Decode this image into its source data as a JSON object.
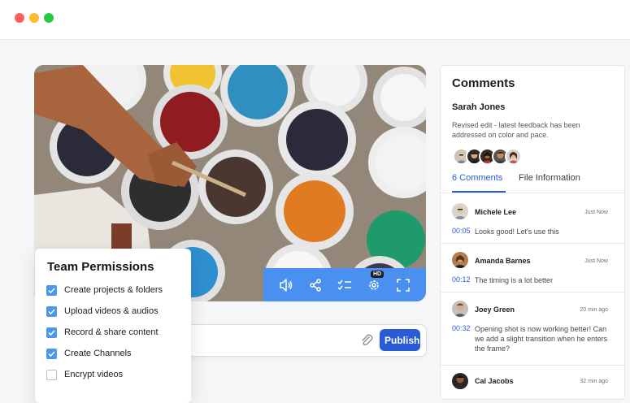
{
  "window": {
    "controls": [
      "close",
      "minimize",
      "maximize"
    ]
  },
  "video": {
    "controls": [
      "volume-icon",
      "share-icon",
      "checklist-icon",
      "settings-icon",
      "fullscreen-icon"
    ],
    "quality_badge": "HD"
  },
  "comment_input": {
    "placeholder": "",
    "publish_label": "Publish"
  },
  "permissions": {
    "title": "Team Permissions",
    "items": [
      {
        "label": "Create projects & folders",
        "checked": true
      },
      {
        "label": "Upload videos & audios",
        "checked": true
      },
      {
        "label": "Record & share content",
        "checked": true
      },
      {
        "label": "Create Channels",
        "checked": true
      },
      {
        "label": "Encrypt videos",
        "checked": false
      }
    ]
  },
  "comments_panel": {
    "title": "Comments",
    "author": "Sarah Jones",
    "description": "Revised edit - latest feedback has been addressed on color and pace.",
    "tabs": [
      {
        "label": "6 Comments",
        "active": true
      },
      {
        "label": "File Information",
        "active": false
      }
    ],
    "comments": [
      {
        "name": "Michele Lee",
        "time": "Just Now",
        "timestamp": "00:05",
        "text": "Looks good! Let's use this"
      },
      {
        "name": "Amanda Barnes",
        "time": "Just Now",
        "timestamp": "00:12",
        "text": "The timing is a lot better"
      },
      {
        "name": "Joey Green",
        "time": "20 min ago",
        "timestamp": "00:32",
        "text": "Opening shot is now working better! Can we add a slight transition when he enters the frame?"
      },
      {
        "name": "Cal Jacobs",
        "time": "32 min ago",
        "timestamp": "",
        "text": ""
      }
    ]
  },
  "colors": {
    "accent": "#2a5bd7",
    "control_bar": "#4a90f0",
    "checkbox": "#4a98ec"
  }
}
